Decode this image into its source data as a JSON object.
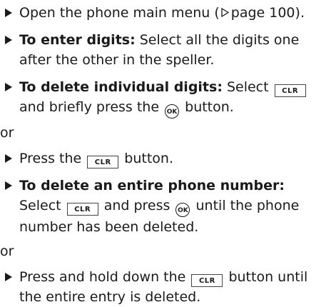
{
  "steps": [
    {
      "pre": "Open the phone main menu (",
      "ref_page": "page 100",
      "post": ")."
    },
    {
      "bold": "To enter digits:",
      "text": " Select all the digits one after the other in the speller."
    },
    {
      "bold": "To delete individual digits:",
      "text1": " Select ",
      "key": "CLR",
      "text2": " and briefly press the ",
      "ok": "OK",
      "text3": " button."
    },
    {
      "text1": "Press the ",
      "key": "CLR",
      "text2": " button."
    },
    {
      "bold": "To delete an entire phone number:",
      "text1": "Select ",
      "key": "CLR",
      "text2": " and press ",
      "ok": "OK",
      "text3": " until the phone number has been deleted."
    },
    {
      "text1": "Press and hold down the ",
      "key": "CLR",
      "text2": " button until the entire entry is deleted."
    }
  ],
  "or_label": "or",
  "icons": {
    "bullet": "filled-triangle-arrow-icon",
    "page_ref": "outline-triangle-icon",
    "ok": "ok-circle-icon",
    "clr": "clr-key-icon"
  }
}
